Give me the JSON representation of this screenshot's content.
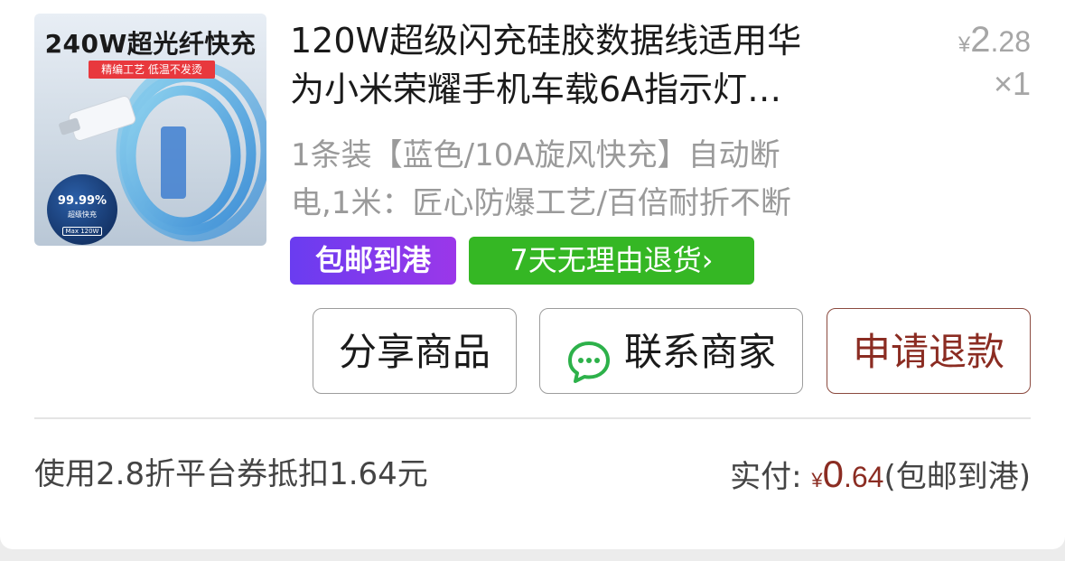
{
  "product": {
    "image": {
      "headline": "240W超光纤快充",
      "ribbon": "精编工艺 低温不发烫",
      "badge_pct": "99.99%",
      "badge_sub": "超级快充",
      "badge_max": "Max 120W"
    },
    "title_line1": "120W超级闪充硅胶数据线适用华",
    "title_line2": "为小米荣耀手机车载6A指示灯…",
    "spec_line1": "1条装【蓝色/10A旋风快充】自动断",
    "spec_line2": "电,1米：匠心防爆工艺/百倍耐折不断",
    "price_currency": "¥",
    "price_int": "2",
    "price_dec": ".28",
    "quantity": "×1"
  },
  "tags": {
    "shipping": "包邮到港",
    "returns": "7天无理由退货",
    "returns_chevron": "›"
  },
  "actions": {
    "share": "分享商品",
    "contact": "联系商家",
    "refund": "申请退款"
  },
  "summary": {
    "coupon_text": "使用2.8折平台券抵扣1.64元",
    "paid_label": "实付:",
    "paid_currency": "¥",
    "paid_int": "0",
    "paid_dec": ".64",
    "paid_note": "(包邮到港)"
  },
  "colors": {
    "accent_refund": "#8b2c22",
    "tag_purple": "#7a3cf0",
    "tag_green": "#35b724",
    "chat_icon": "#2db14a"
  },
  "icons": {
    "contact": "chat-bubble-icon",
    "returns": "chevron-right-icon"
  }
}
